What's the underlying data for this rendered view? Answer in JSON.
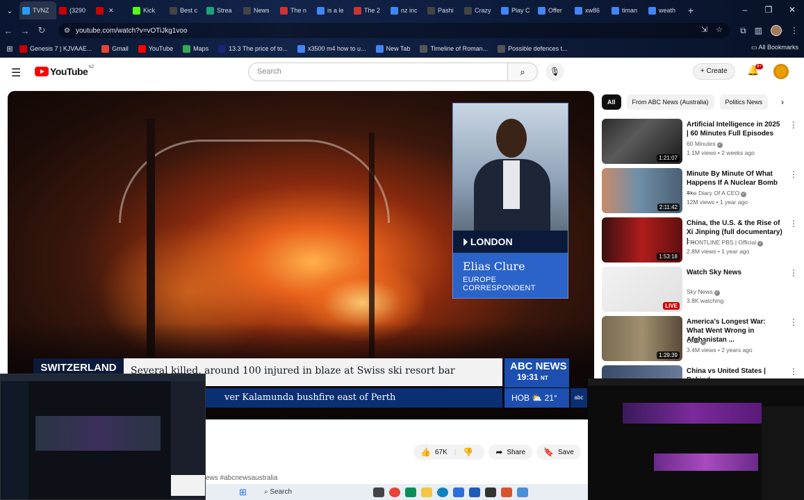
{
  "browser": {
    "tabs": [
      {
        "label": "TVNZ",
        "color": "#2a9df4"
      },
      {
        "label": "(3290",
        "color": "#cc0000"
      },
      {
        "label": "",
        "color": "#cc0000"
      },
      {
        "label": "Kick",
        "color": "#53fc18"
      },
      {
        "label": "Best c",
        "color": "#444444"
      },
      {
        "label": "Strea",
        "color": "#1aa37a"
      },
      {
        "label": "News",
        "color": "#444444"
      },
      {
        "label": "The n",
        "color": "#cc3333"
      },
      {
        "label": "is a le",
        "color": "#4285f4"
      },
      {
        "label": "The 2",
        "color": "#cc3333"
      },
      {
        "label": "nz inc",
        "color": "#4285f4"
      },
      {
        "label": "Pashi",
        "color": "#444444"
      },
      {
        "label": "Crazy",
        "color": "#444444"
      },
      {
        "label": "Play C",
        "color": "#4285f4"
      },
      {
        "label": "Offer",
        "color": "#4285f4"
      },
      {
        "label": "xw86",
        "color": "#4285f4"
      },
      {
        "label": "timan",
        "color": "#4285f4"
      },
      {
        "label": "weath",
        "color": "#4285f4"
      }
    ],
    "url": "youtube.com/watch?v=vOTiJkg1voo",
    "bookmarks": [
      {
        "label": "Genesis 7 | KJVAAE...",
        "color": "#cc0000"
      },
      {
        "label": "Gmail",
        "color": "#ea4335"
      },
      {
        "label": "YouTube",
        "color": "#ff0000"
      },
      {
        "label": "Maps",
        "color": "#34a853"
      },
      {
        "label": "13.3 The price of to...",
        "color": "#1a237e"
      },
      {
        "label": "x3500 m4 how to u...",
        "color": "#4285f4"
      },
      {
        "label": "New Tab",
        "color": "#4285f4"
      },
      {
        "label": "Timeline of Roman...",
        "color": "#555555"
      },
      {
        "label": "Possible defences t...",
        "color": "#555555"
      }
    ],
    "all_bookmarks": "All Bookmarks"
  },
  "youtube": {
    "logo_text": "YouTube",
    "country": "NZ",
    "search_placeholder": "Search",
    "create_label": "Create",
    "notifications_badge": "9+"
  },
  "video": {
    "pip_location": "LONDON",
    "pip_name": "Elias Clure",
    "pip_role_1": "EUROPE",
    "pip_role_2": "CORRESPONDENT",
    "ticker_tag": "SWITZERLAND",
    "ticker_headline": "Several killed, around 100 injured in blaze at Swiss ski resort bar",
    "ticker_sub": "ver Kalamunda bushfire east of Perth",
    "channel_logo": "ABC NEWS",
    "time": "19:31",
    "time_zone": "NT",
    "weather_city": "HOB",
    "weather_temp": "21°"
  },
  "actions": {
    "likes": "67K",
    "share": "Share",
    "save": "Save"
  },
  "hashtags": "ews #abcnewsaustralia",
  "chips": [
    "All",
    "From ABC News (Australia)",
    "Politics News"
  ],
  "recommendations": [
    {
      "title": "Artificial Intelligence in 2025 | 60 Minutes Full Episodes",
      "channel": "60 Minutes",
      "meta": "1.1M views • 2 weeks ago",
      "duration": "1:21:07",
      "thumb": "linear-gradient(135deg,#2c2c2c,#5a5a5a 40%,#1a1a1a)"
    },
    {
      "title": "Minute By Minute Of What Happens If A Nuclear Bomb ...",
      "channel": "The Diary Of A CEO",
      "meta": "12M views • 1 year ago",
      "duration": "2:11:42",
      "thumb": "linear-gradient(90deg,#c98a6a,#6f8fa8 45%,#4a6074)"
    },
    {
      "title": "China, the U.S. & the Rise of Xi Jinping (full documentary) | ...",
      "channel": "FRONTLINE PBS | Official",
      "meta": "2.8M views • 1 year ago",
      "duration": "1:53:18",
      "thumb": "linear-gradient(90deg,#3a1010,#b01c1c 50%,#601010)"
    },
    {
      "title": "Watch Sky News",
      "channel": "Sky News",
      "meta": "3.8K watching",
      "duration": "LIVE",
      "thumb": "linear-gradient(135deg,#f2f2f2,#e0e0e0)"
    },
    {
      "title": "America's Longest War: What Went Wrong in Afghanistan ...",
      "channel": "CNN",
      "meta": "3.4M views • 2 years ago",
      "duration": "1:29:39",
      "thumb": "linear-gradient(90deg,#7a6a50,#a09070 50%,#5a4a38)"
    },
    {
      "title": "China vs United States | Behind",
      "channel": "",
      "meta": "",
      "duration": "",
      "thumb": "linear-gradient(90deg,#3a4a6a,#6a7a9a)"
    }
  ],
  "taskbar": {
    "search": "Search"
  }
}
